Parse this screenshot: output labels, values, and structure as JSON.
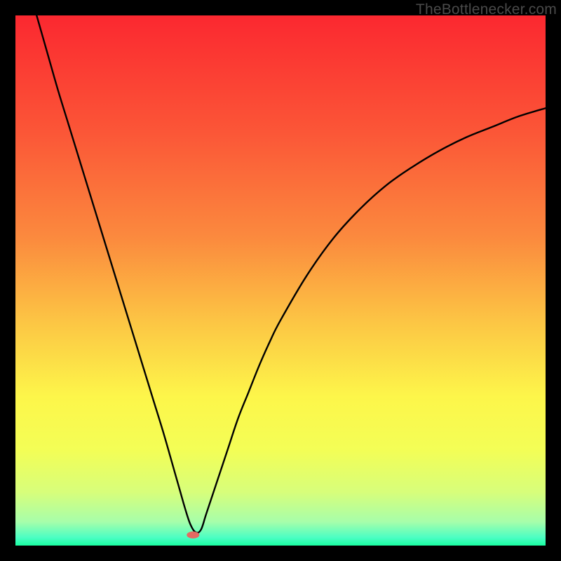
{
  "watermark": "TheBottlenecker.com",
  "colors": {
    "frame": "#000000",
    "curve": "#000000",
    "marker": "#e46a62",
    "gradient_stops": [
      {
        "offset": 0.0,
        "color": "#fb2830"
      },
      {
        "offset": 0.22,
        "color": "#fb5637"
      },
      {
        "offset": 0.42,
        "color": "#fb8a3e"
      },
      {
        "offset": 0.58,
        "color": "#fcc644"
      },
      {
        "offset": 0.72,
        "color": "#fdf64a"
      },
      {
        "offset": 0.82,
        "color": "#f3fe56"
      },
      {
        "offset": 0.9,
        "color": "#d7fe7b"
      },
      {
        "offset": 0.955,
        "color": "#a7feaa"
      },
      {
        "offset": 0.985,
        "color": "#4bfec3"
      },
      {
        "offset": 1.0,
        "color": "#19fea1"
      }
    ]
  },
  "chart_data": {
    "type": "line",
    "title": "",
    "xlabel": "",
    "ylabel": "",
    "xlim": [
      0,
      100
    ],
    "ylim": [
      0,
      100
    ],
    "marker": {
      "x": 33.5,
      "y": 2.0
    },
    "series": [
      {
        "name": "curve",
        "x": [
          0,
          2,
          4,
          6,
          8,
          10,
          12,
          14,
          16,
          18,
          20,
          22,
          24,
          26,
          28,
          30,
          31,
          32,
          33,
          34,
          35,
          36,
          38,
          40,
          42,
          44,
          46,
          48,
          50,
          55,
          60,
          65,
          70,
          75,
          80,
          85,
          90,
          95,
          100
        ],
        "y": [
          115,
          107,
          100,
          93,
          86,
          79.5,
          73,
          66.5,
          60,
          53.5,
          47,
          40.5,
          34,
          27.5,
          21,
          14,
          10.5,
          7,
          4,
          2.5,
          3,
          6,
          12,
          18,
          24,
          29,
          34,
          38.5,
          42.5,
          51,
          58,
          63.5,
          68,
          71.5,
          74.5,
          77,
          79,
          81,
          82.5
        ]
      }
    ]
  }
}
